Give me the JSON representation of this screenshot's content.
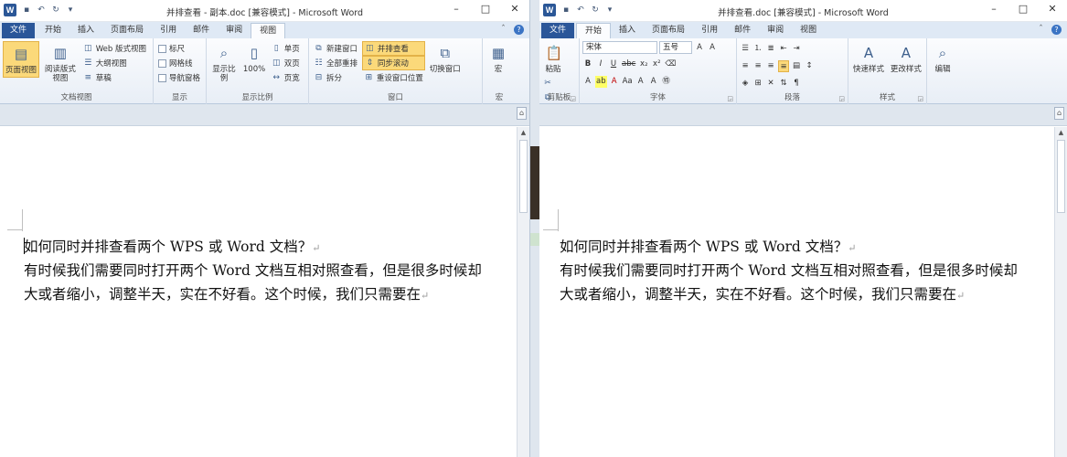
{
  "left": {
    "title": "并排查看 - 副本.doc [兼容模式] - Microsoft Word",
    "tabs": [
      "文件",
      "开始",
      "插入",
      "页面布局",
      "引用",
      "邮件",
      "审阅",
      "视图"
    ],
    "groups": {
      "doc_views": {
        "label": "文档视图",
        "print_layout": "页面视图",
        "read_mode": "阅读版式视图",
        "web_layout": "Web 版式视图",
        "outline": "大纲视图",
        "draft": "草稿"
      },
      "show": {
        "label": "显示",
        "ruler": "标尺",
        "gridlines": "网格线",
        "nav_pane": "导航窗格"
      },
      "zoom": {
        "label": "显示比例",
        "zoom": "显示比例",
        "percent": "100%",
        "one_page": "单页",
        "two_pages": "双页",
        "page_width": "页宽"
      },
      "window": {
        "label": "窗口",
        "new_window": "新建窗口",
        "arrange_all": "全部重排",
        "split": "拆分",
        "side_by_side": "并排查看",
        "sync_scroll": "同步滚动",
        "reset_position": "重设窗口位置",
        "switch_windows": "切换窗口"
      },
      "macros": {
        "label": "宏",
        "macro": "宏"
      }
    }
  },
  "right": {
    "title": "并排查看.doc [兼容模式] - Microsoft Word",
    "tabs": [
      "文件",
      "开始",
      "插入",
      "页面布局",
      "引用",
      "邮件",
      "审阅",
      "视图"
    ],
    "groups": {
      "clipboard": {
        "label": "剪贴板",
        "paste": "粘贴"
      },
      "font": {
        "label": "字体",
        "font_name": "宋体",
        "font_size": "五号"
      },
      "paragraph": {
        "label": "段落"
      },
      "styles": {
        "label": "样式",
        "quick_styles": "快速样式",
        "change_styles": "更改样式"
      },
      "editing": {
        "label": "编辑",
        "editing": "编辑"
      }
    }
  },
  "document": {
    "lines": [
      "如何同时并排查看两个 WPS 或 Word 文档？",
      "有时候我们需要同时打开两个 Word 文档互相对照查看，但是很多时候却",
      "大或者缩小，调整半天，实在不好看。这个时候，我们只需要在"
    ]
  },
  "colors": {
    "file_tab": "#2a5699",
    "pressed": "#fbd97a",
    "ribbon_bg": "#e8eef6"
  }
}
